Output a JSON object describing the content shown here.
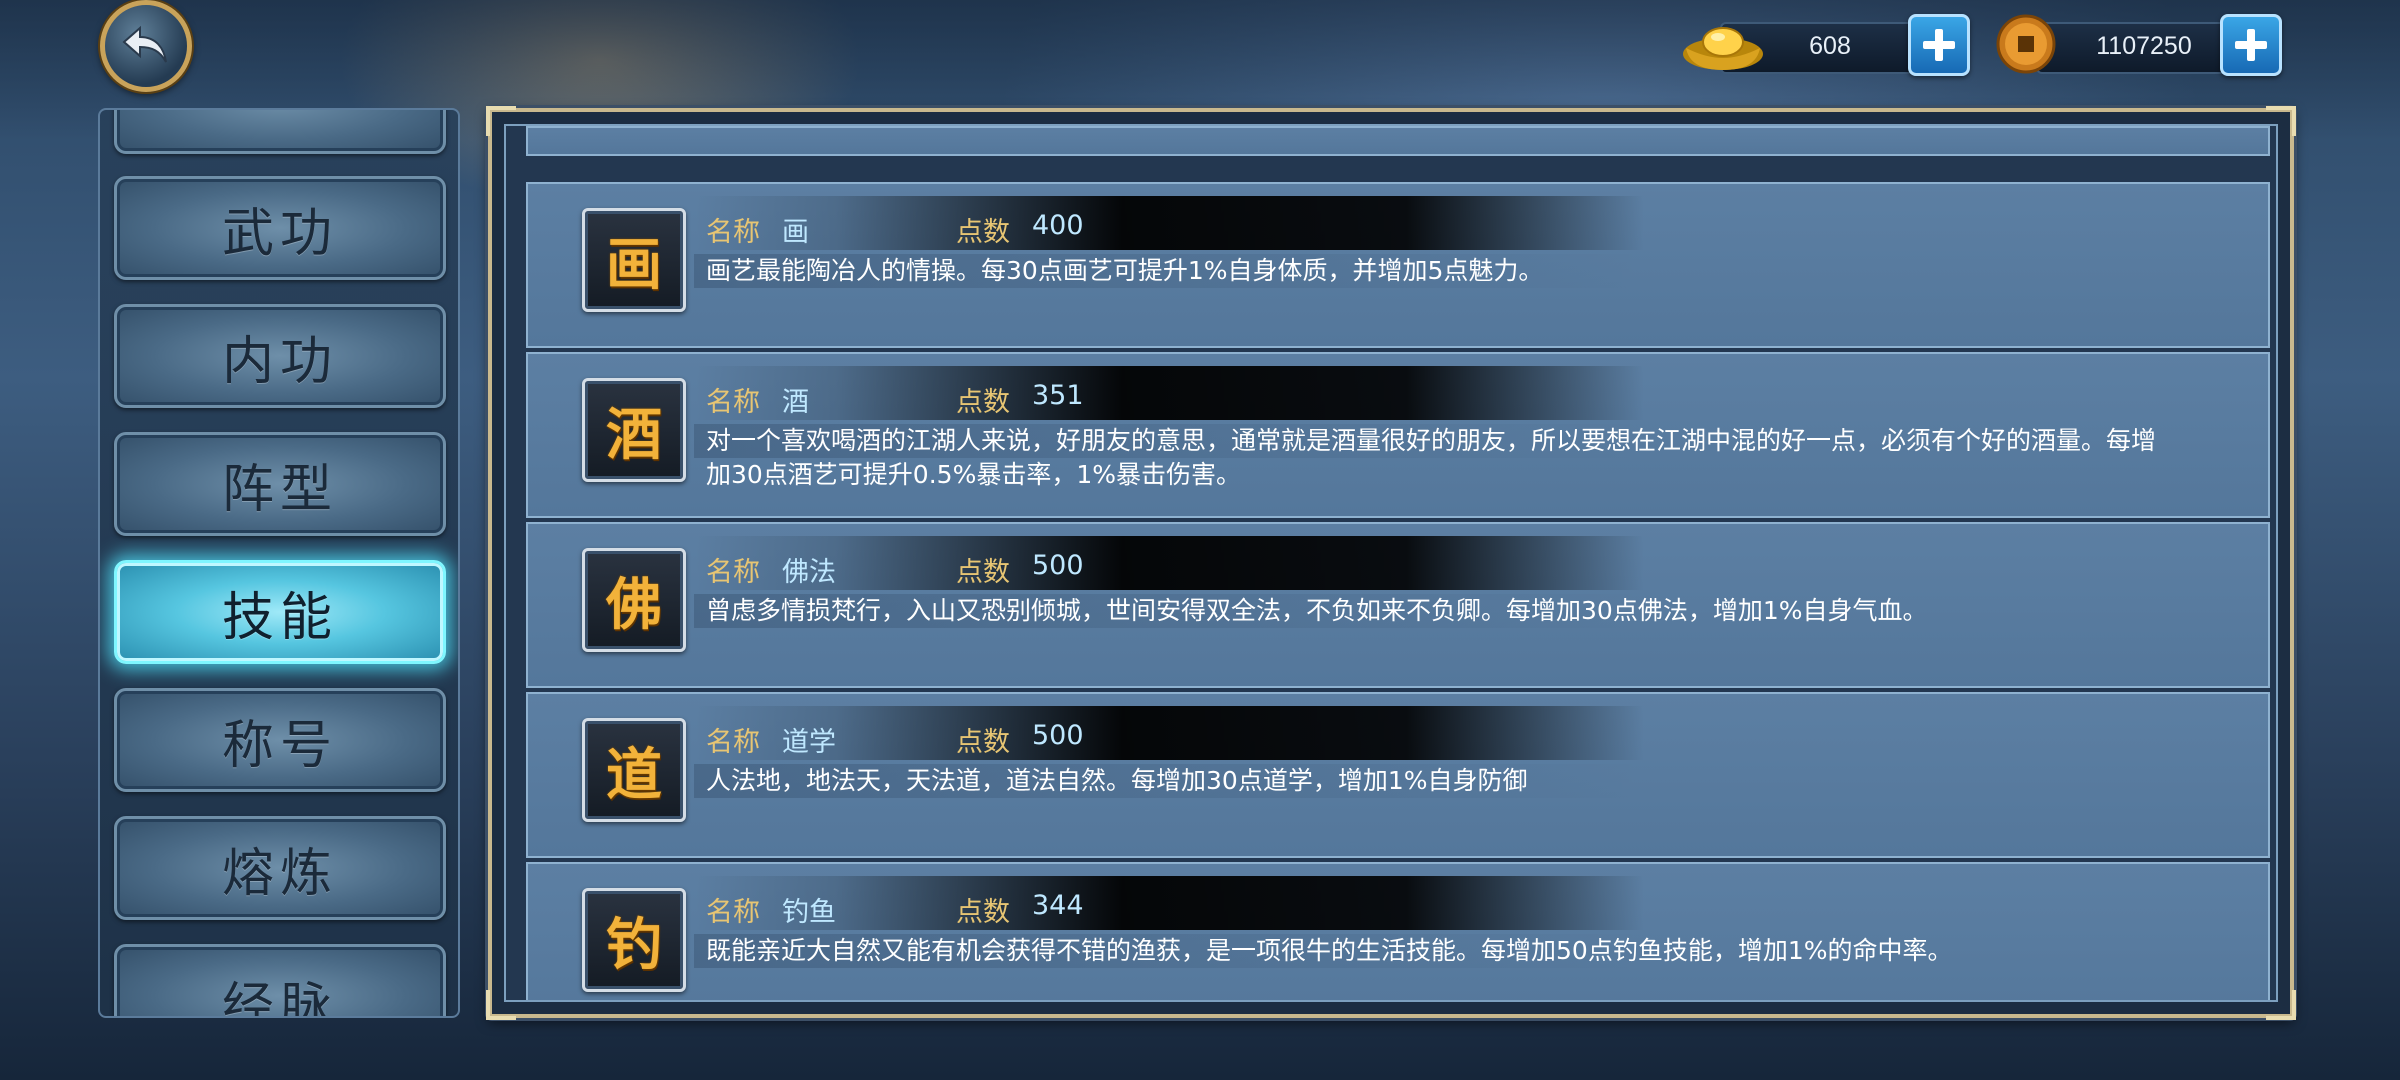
{
  "currency": {
    "gold": {
      "icon": "gold-ingot-icon",
      "value": "608"
    },
    "coins": {
      "icon": "copper-coin-icon",
      "value": "1107250"
    }
  },
  "menu": {
    "items": [
      {
        "label": "武功",
        "active": false
      },
      {
        "label": "内功",
        "active": false
      },
      {
        "label": "阵型",
        "active": false
      },
      {
        "label": "技能",
        "active": true
      },
      {
        "label": "称号",
        "active": false
      },
      {
        "label": "熔炼",
        "active": false
      },
      {
        "label": "经脉",
        "active": false
      }
    ]
  },
  "skills": {
    "name_label": "名称",
    "points_label": "点数",
    "items": [
      {
        "glyph": "画",
        "name": "画",
        "points": "400",
        "desc": "画艺最能陶冶人的情操。每30点画艺可提升1%自身体质，并增加5点魅力。"
      },
      {
        "glyph": "酒",
        "name": "酒",
        "points": "351",
        "desc": "对一个喜欢喝酒的江湖人来说，好朋友的意思，通常就是酒量很好的朋友，所以要想在江湖中混的好一点，必须有个好的酒量。每增加30点酒艺可提升0.5%暴击率，1%暴击伤害。"
      },
      {
        "glyph": "佛",
        "name": "佛法",
        "points": "500",
        "desc": "曾虑多情损梵行，入山又恐别倾城，世间安得双全法，不负如来不负卿。每增加30点佛法，增加1%自身气血。"
      },
      {
        "glyph": "道",
        "name": "道学",
        "points": "500",
        "desc": "人法地，地法天，天法道，道法自然。每增加30点道学，增加1%自身防御"
      },
      {
        "glyph": "钓",
        "name": "钓鱼",
        "points": "344",
        "desc": "既能亲近大自然又能有机会获得不错的渔获，是一项很牛的生活技能。每增加50点钓鱼技能，增加1%的命中率。"
      }
    ]
  },
  "colors": {
    "accent": "#56c6e0",
    "label_gold": "#e7c573",
    "value_blue": "#bfe8ff",
    "glyph_orange": "#f2b23a"
  }
}
